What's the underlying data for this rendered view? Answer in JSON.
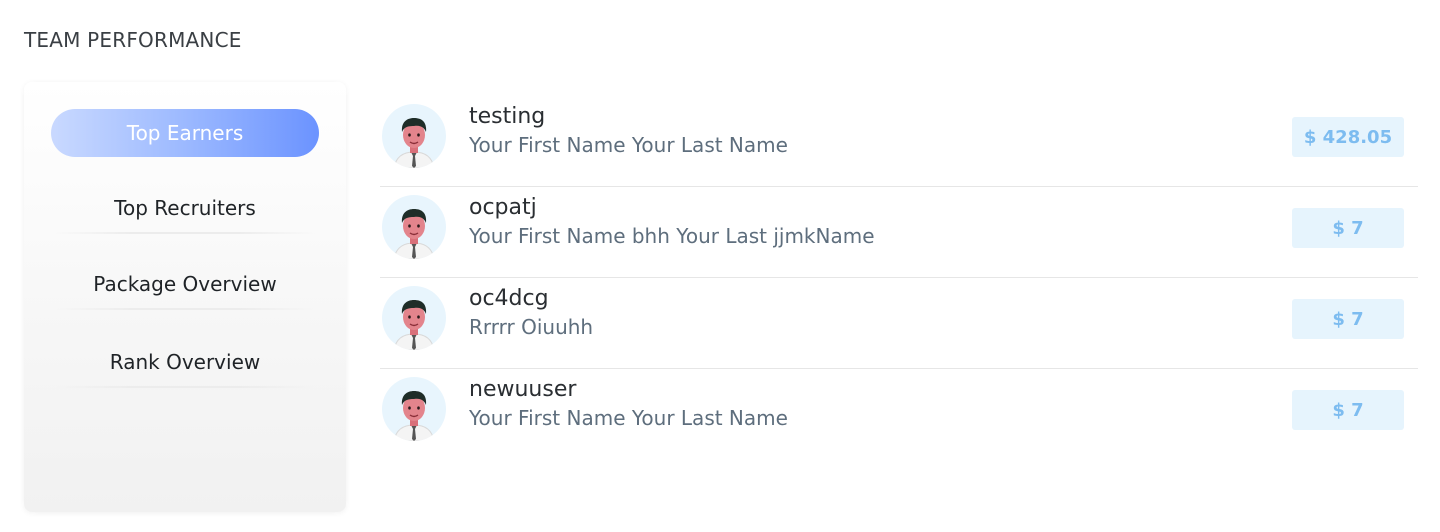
{
  "section": {
    "title": "TEAM PERFORMANCE"
  },
  "tabs": [
    {
      "label": "Top Earners",
      "active": true
    },
    {
      "label": "Top Recruiters",
      "active": false
    },
    {
      "label": "Package Overview",
      "active": false
    },
    {
      "label": "Rank Overview",
      "active": false
    }
  ],
  "earners": [
    {
      "username": "testing",
      "full_name": "Your First Name Your Last Name",
      "amount": "$ 428.05"
    },
    {
      "username": "ocpatj",
      "full_name": "Your First Name bhh Your Last jjmkName",
      "amount": "$ 7"
    },
    {
      "username": "oc4dcg",
      "full_name": "Rrrrr Oiuuhh",
      "amount": "$ 7"
    },
    {
      "username": "newuuser",
      "full_name": "Your First Name Your Last Name",
      "amount": "$ 7"
    }
  ],
  "colors": {
    "tab_active_gradient_start": "#c9d9ff",
    "tab_active_gradient_end": "#6b93ff",
    "amount_badge_bg": "#e6f4fd",
    "amount_text": "#7dbcf0",
    "avatar_bg": "#e8f5fd"
  },
  "icons": {
    "avatar": "user-avatar-icon"
  }
}
